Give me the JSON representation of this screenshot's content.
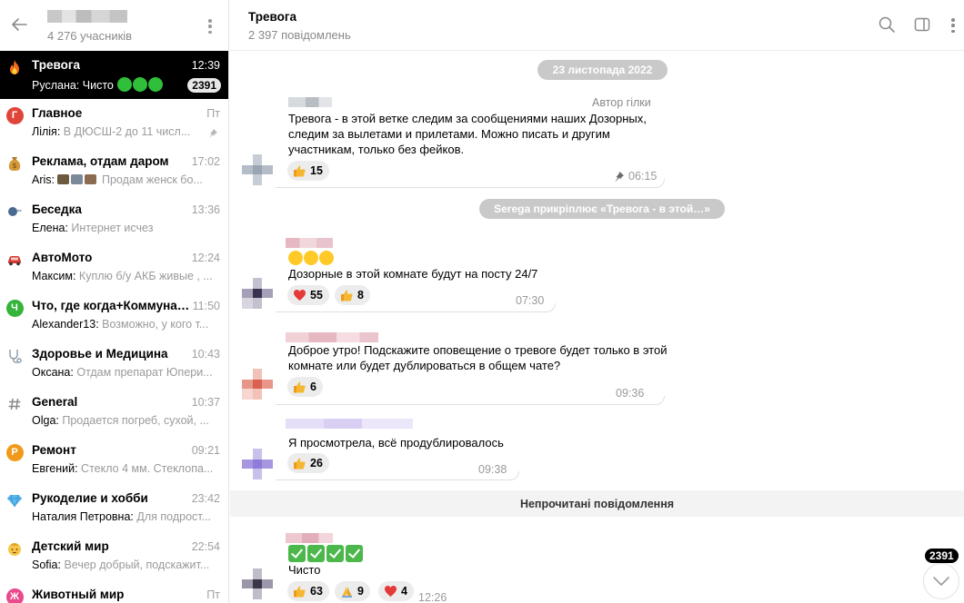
{
  "sidebar": {
    "member_count": "4 276 учасників",
    "topics": [
      {
        "name": "Тревога",
        "time": "12:39",
        "author": "Руслана:",
        "preview": "Чисто",
        "badge": "2391",
        "icon": "fire-icon",
        "active": true
      },
      {
        "name": "Главное",
        "time": "Пт",
        "author": "Лілія:",
        "preview": "В ДЮСШ-2 до 11 числ...",
        "icon": "letter-icon",
        "letter": "Г",
        "color": "#e0453a",
        "pinned": true
      },
      {
        "name": "Реклама, отдам даром",
        "time": "17:02",
        "author": "Aris:",
        "preview": "Продам женск бо...",
        "icon": "money-bag-icon"
      },
      {
        "name": "Беседка",
        "time": "13:36",
        "author": "Елена:",
        "preview": "Интернет исчез",
        "icon": "speech-icon"
      },
      {
        "name": "АвтоМото",
        "time": "12:24",
        "author": "Максим:",
        "preview": "Куплю б/у АКБ живые , ...",
        "icon": "car-icon"
      },
      {
        "name": "Что, где когда+Коммунал...",
        "time": "11:50",
        "author": "Alexander13:",
        "preview": "Возможно, у кого т...",
        "icon": "letter-icon",
        "letter": "Ч",
        "color": "#35b33a"
      },
      {
        "name": "Здоровье и Медицина",
        "time": "10:43",
        "author": "Оксана:",
        "preview": "Отдам препарат Юпери...",
        "icon": "stethoscope-icon"
      },
      {
        "name": "General",
        "time": "10:37",
        "author": "Olga:",
        "preview": "Продается погреб, сухой, ...",
        "icon": "hash-icon"
      },
      {
        "name": "Ремонт",
        "time": "09:21",
        "author": "Евгений:",
        "preview": "Стекло 4 мм. Стеклопа...",
        "icon": "letter-icon",
        "letter": "Р",
        "color": "#f09a1c"
      },
      {
        "name": "Рукоделие и хобби",
        "time": "23:42",
        "author": "Наталия Петровна:",
        "preview": "Для подрост...",
        "icon": "diamond-icon"
      },
      {
        "name": "Детский мир",
        "time": "22:54",
        "author": "Sofia:",
        "preview": "Вечер добрый, подскажит...",
        "icon": "baby-icon"
      },
      {
        "name": "Животный мир",
        "time": "Пт",
        "author": "",
        "preview": "",
        "icon": "letter-icon",
        "letter": "Ж",
        "color": "#e84a8a"
      }
    ]
  },
  "chat": {
    "title": "Тревога",
    "message_count": "2 397 повідомлень",
    "date_separator": "23 листопада 2022",
    "service_message": "Serega прикріплює «Тревога - в этой…»",
    "unread_divider": "Непрочитані повідомлення",
    "scroll_badge": "2391",
    "messages": [
      {
        "author_label": "Автор гілки",
        "text": "Тревога - в этой ветке следим за сообщениями наших Дозорных, следим за вылетами и прилетами. Можно писать и другим участникам, только без фейков.",
        "time": "06:15",
        "reactions": [
          {
            "emoji": "thumbs-up",
            "count": "15"
          }
        ]
      },
      {
        "text": "Дозорные в этой комнате будут на посту 24/7",
        "time": "07:30",
        "reactions": [
          {
            "emoji": "heart",
            "count": "55"
          },
          {
            "emoji": "thumbs-up",
            "count": "8"
          }
        ]
      },
      {
        "text": "Доброе утро! Подскажите оповещение о тревоге будет только в этой комнате или будет дублироваться в общем чате?",
        "time": "09:36",
        "reactions": [
          {
            "emoji": "thumbs-up",
            "count": "6"
          }
        ]
      },
      {
        "text": "Я просмотрела, всё продублировалось",
        "time": "09:38",
        "reactions": [
          {
            "emoji": "thumbs-up",
            "count": "26"
          }
        ]
      },
      {
        "text": "Чисто",
        "time": "12:26",
        "reactions": [
          {
            "emoji": "thumbs-up",
            "count": "63"
          },
          {
            "emoji": "pray",
            "count": "9"
          },
          {
            "emoji": "heart",
            "count": "4"
          }
        ]
      }
    ]
  },
  "colors": {
    "accent_green": "#2fbf3a",
    "pill_gray": "#c9c9c9",
    "reaction_bg": "#ececec",
    "active_bg": "#000000"
  }
}
